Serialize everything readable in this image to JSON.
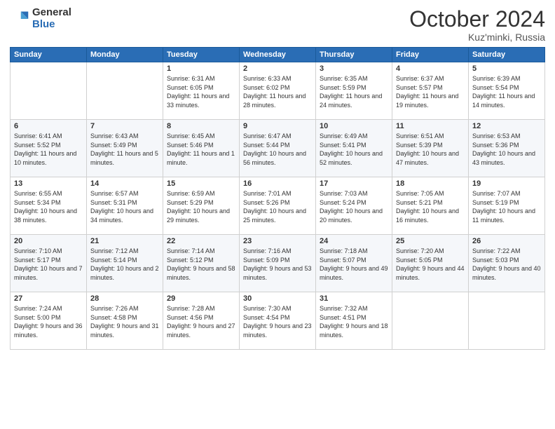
{
  "logo": {
    "general": "General",
    "blue": "Blue"
  },
  "title": {
    "month": "October 2024",
    "location": "Kuz'minki, Russia"
  },
  "weekdays": [
    "Sunday",
    "Monday",
    "Tuesday",
    "Wednesday",
    "Thursday",
    "Friday",
    "Saturday"
  ],
  "weeks": [
    [
      {
        "day": "",
        "sunrise": "",
        "sunset": "",
        "daylight": ""
      },
      {
        "day": "",
        "sunrise": "",
        "sunset": "",
        "daylight": ""
      },
      {
        "day": "1",
        "sunrise": "Sunrise: 6:31 AM",
        "sunset": "Sunset: 6:05 PM",
        "daylight": "Daylight: 11 hours and 33 minutes."
      },
      {
        "day": "2",
        "sunrise": "Sunrise: 6:33 AM",
        "sunset": "Sunset: 6:02 PM",
        "daylight": "Daylight: 11 hours and 28 minutes."
      },
      {
        "day": "3",
        "sunrise": "Sunrise: 6:35 AM",
        "sunset": "Sunset: 5:59 PM",
        "daylight": "Daylight: 11 hours and 24 minutes."
      },
      {
        "day": "4",
        "sunrise": "Sunrise: 6:37 AM",
        "sunset": "Sunset: 5:57 PM",
        "daylight": "Daylight: 11 hours and 19 minutes."
      },
      {
        "day": "5",
        "sunrise": "Sunrise: 6:39 AM",
        "sunset": "Sunset: 5:54 PM",
        "daylight": "Daylight: 11 hours and 14 minutes."
      }
    ],
    [
      {
        "day": "6",
        "sunrise": "Sunrise: 6:41 AM",
        "sunset": "Sunset: 5:52 PM",
        "daylight": "Daylight: 11 hours and 10 minutes."
      },
      {
        "day": "7",
        "sunrise": "Sunrise: 6:43 AM",
        "sunset": "Sunset: 5:49 PM",
        "daylight": "Daylight: 11 hours and 5 minutes."
      },
      {
        "day": "8",
        "sunrise": "Sunrise: 6:45 AM",
        "sunset": "Sunset: 5:46 PM",
        "daylight": "Daylight: 11 hours and 1 minute."
      },
      {
        "day": "9",
        "sunrise": "Sunrise: 6:47 AM",
        "sunset": "Sunset: 5:44 PM",
        "daylight": "Daylight: 10 hours and 56 minutes."
      },
      {
        "day": "10",
        "sunrise": "Sunrise: 6:49 AM",
        "sunset": "Sunset: 5:41 PM",
        "daylight": "Daylight: 10 hours and 52 minutes."
      },
      {
        "day": "11",
        "sunrise": "Sunrise: 6:51 AM",
        "sunset": "Sunset: 5:39 PM",
        "daylight": "Daylight: 10 hours and 47 minutes."
      },
      {
        "day": "12",
        "sunrise": "Sunrise: 6:53 AM",
        "sunset": "Sunset: 5:36 PM",
        "daylight": "Daylight: 10 hours and 43 minutes."
      }
    ],
    [
      {
        "day": "13",
        "sunrise": "Sunrise: 6:55 AM",
        "sunset": "Sunset: 5:34 PM",
        "daylight": "Daylight: 10 hours and 38 minutes."
      },
      {
        "day": "14",
        "sunrise": "Sunrise: 6:57 AM",
        "sunset": "Sunset: 5:31 PM",
        "daylight": "Daylight: 10 hours and 34 minutes."
      },
      {
        "day": "15",
        "sunrise": "Sunrise: 6:59 AM",
        "sunset": "Sunset: 5:29 PM",
        "daylight": "Daylight: 10 hours and 29 minutes."
      },
      {
        "day": "16",
        "sunrise": "Sunrise: 7:01 AM",
        "sunset": "Sunset: 5:26 PM",
        "daylight": "Daylight: 10 hours and 25 minutes."
      },
      {
        "day": "17",
        "sunrise": "Sunrise: 7:03 AM",
        "sunset": "Sunset: 5:24 PM",
        "daylight": "Daylight: 10 hours and 20 minutes."
      },
      {
        "day": "18",
        "sunrise": "Sunrise: 7:05 AM",
        "sunset": "Sunset: 5:21 PM",
        "daylight": "Daylight: 10 hours and 16 minutes."
      },
      {
        "day": "19",
        "sunrise": "Sunrise: 7:07 AM",
        "sunset": "Sunset: 5:19 PM",
        "daylight": "Daylight: 10 hours and 11 minutes."
      }
    ],
    [
      {
        "day": "20",
        "sunrise": "Sunrise: 7:10 AM",
        "sunset": "Sunset: 5:17 PM",
        "daylight": "Daylight: 10 hours and 7 minutes."
      },
      {
        "day": "21",
        "sunrise": "Sunrise: 7:12 AM",
        "sunset": "Sunset: 5:14 PM",
        "daylight": "Daylight: 10 hours and 2 minutes."
      },
      {
        "day": "22",
        "sunrise": "Sunrise: 7:14 AM",
        "sunset": "Sunset: 5:12 PM",
        "daylight": "Daylight: 9 hours and 58 minutes."
      },
      {
        "day": "23",
        "sunrise": "Sunrise: 7:16 AM",
        "sunset": "Sunset: 5:09 PM",
        "daylight": "Daylight: 9 hours and 53 minutes."
      },
      {
        "day": "24",
        "sunrise": "Sunrise: 7:18 AM",
        "sunset": "Sunset: 5:07 PM",
        "daylight": "Daylight: 9 hours and 49 minutes."
      },
      {
        "day": "25",
        "sunrise": "Sunrise: 7:20 AM",
        "sunset": "Sunset: 5:05 PM",
        "daylight": "Daylight: 9 hours and 44 minutes."
      },
      {
        "day": "26",
        "sunrise": "Sunrise: 7:22 AM",
        "sunset": "Sunset: 5:03 PM",
        "daylight": "Daylight: 9 hours and 40 minutes."
      }
    ],
    [
      {
        "day": "27",
        "sunrise": "Sunrise: 7:24 AM",
        "sunset": "Sunset: 5:00 PM",
        "daylight": "Daylight: 9 hours and 36 minutes."
      },
      {
        "day": "28",
        "sunrise": "Sunrise: 7:26 AM",
        "sunset": "Sunset: 4:58 PM",
        "daylight": "Daylight: 9 hours and 31 minutes."
      },
      {
        "day": "29",
        "sunrise": "Sunrise: 7:28 AM",
        "sunset": "Sunset: 4:56 PM",
        "daylight": "Daylight: 9 hours and 27 minutes."
      },
      {
        "day": "30",
        "sunrise": "Sunrise: 7:30 AM",
        "sunset": "Sunset: 4:54 PM",
        "daylight": "Daylight: 9 hours and 23 minutes."
      },
      {
        "day": "31",
        "sunrise": "Sunrise: 7:32 AM",
        "sunset": "Sunset: 4:51 PM",
        "daylight": "Daylight: 9 hours and 18 minutes."
      },
      {
        "day": "",
        "sunrise": "",
        "sunset": "",
        "daylight": ""
      },
      {
        "day": "",
        "sunrise": "",
        "sunset": "",
        "daylight": ""
      }
    ]
  ]
}
